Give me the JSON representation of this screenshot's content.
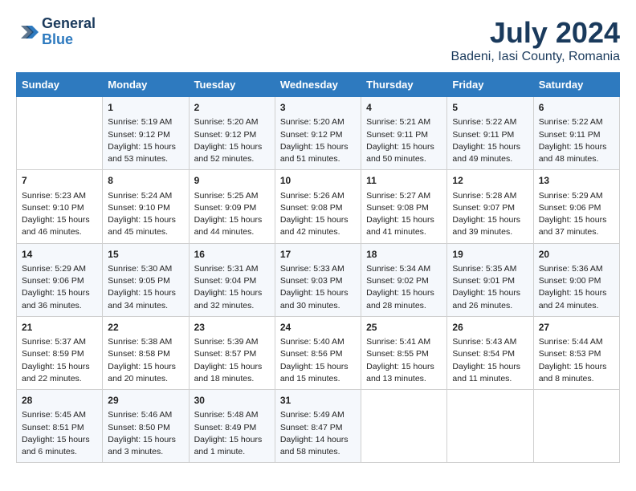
{
  "header": {
    "logo_line1": "General",
    "logo_line2": "Blue",
    "title": "July 2024",
    "subtitle": "Badeni, Iasi County, Romania"
  },
  "days_of_week": [
    "Sunday",
    "Monday",
    "Tuesday",
    "Wednesday",
    "Thursday",
    "Friday",
    "Saturday"
  ],
  "weeks": [
    [
      {
        "day": "",
        "content": ""
      },
      {
        "day": "1",
        "content": "Sunrise: 5:19 AM\nSunset: 9:12 PM\nDaylight: 15 hours\nand 53 minutes."
      },
      {
        "day": "2",
        "content": "Sunrise: 5:20 AM\nSunset: 9:12 PM\nDaylight: 15 hours\nand 52 minutes."
      },
      {
        "day": "3",
        "content": "Sunrise: 5:20 AM\nSunset: 9:12 PM\nDaylight: 15 hours\nand 51 minutes."
      },
      {
        "day": "4",
        "content": "Sunrise: 5:21 AM\nSunset: 9:11 PM\nDaylight: 15 hours\nand 50 minutes."
      },
      {
        "day": "5",
        "content": "Sunrise: 5:22 AM\nSunset: 9:11 PM\nDaylight: 15 hours\nand 49 minutes."
      },
      {
        "day": "6",
        "content": "Sunrise: 5:22 AM\nSunset: 9:11 PM\nDaylight: 15 hours\nand 48 minutes."
      }
    ],
    [
      {
        "day": "7",
        "content": "Sunrise: 5:23 AM\nSunset: 9:10 PM\nDaylight: 15 hours\nand 46 minutes."
      },
      {
        "day": "8",
        "content": "Sunrise: 5:24 AM\nSunset: 9:10 PM\nDaylight: 15 hours\nand 45 minutes."
      },
      {
        "day": "9",
        "content": "Sunrise: 5:25 AM\nSunset: 9:09 PM\nDaylight: 15 hours\nand 44 minutes."
      },
      {
        "day": "10",
        "content": "Sunrise: 5:26 AM\nSunset: 9:08 PM\nDaylight: 15 hours\nand 42 minutes."
      },
      {
        "day": "11",
        "content": "Sunrise: 5:27 AM\nSunset: 9:08 PM\nDaylight: 15 hours\nand 41 minutes."
      },
      {
        "day": "12",
        "content": "Sunrise: 5:28 AM\nSunset: 9:07 PM\nDaylight: 15 hours\nand 39 minutes."
      },
      {
        "day": "13",
        "content": "Sunrise: 5:29 AM\nSunset: 9:06 PM\nDaylight: 15 hours\nand 37 minutes."
      }
    ],
    [
      {
        "day": "14",
        "content": "Sunrise: 5:29 AM\nSunset: 9:06 PM\nDaylight: 15 hours\nand 36 minutes."
      },
      {
        "day": "15",
        "content": "Sunrise: 5:30 AM\nSunset: 9:05 PM\nDaylight: 15 hours\nand 34 minutes."
      },
      {
        "day": "16",
        "content": "Sunrise: 5:31 AM\nSunset: 9:04 PM\nDaylight: 15 hours\nand 32 minutes."
      },
      {
        "day": "17",
        "content": "Sunrise: 5:33 AM\nSunset: 9:03 PM\nDaylight: 15 hours\nand 30 minutes."
      },
      {
        "day": "18",
        "content": "Sunrise: 5:34 AM\nSunset: 9:02 PM\nDaylight: 15 hours\nand 28 minutes."
      },
      {
        "day": "19",
        "content": "Sunrise: 5:35 AM\nSunset: 9:01 PM\nDaylight: 15 hours\nand 26 minutes."
      },
      {
        "day": "20",
        "content": "Sunrise: 5:36 AM\nSunset: 9:00 PM\nDaylight: 15 hours\nand 24 minutes."
      }
    ],
    [
      {
        "day": "21",
        "content": "Sunrise: 5:37 AM\nSunset: 8:59 PM\nDaylight: 15 hours\nand 22 minutes."
      },
      {
        "day": "22",
        "content": "Sunrise: 5:38 AM\nSunset: 8:58 PM\nDaylight: 15 hours\nand 20 minutes."
      },
      {
        "day": "23",
        "content": "Sunrise: 5:39 AM\nSunset: 8:57 PM\nDaylight: 15 hours\nand 18 minutes."
      },
      {
        "day": "24",
        "content": "Sunrise: 5:40 AM\nSunset: 8:56 PM\nDaylight: 15 hours\nand 15 minutes."
      },
      {
        "day": "25",
        "content": "Sunrise: 5:41 AM\nSunset: 8:55 PM\nDaylight: 15 hours\nand 13 minutes."
      },
      {
        "day": "26",
        "content": "Sunrise: 5:43 AM\nSunset: 8:54 PM\nDaylight: 15 hours\nand 11 minutes."
      },
      {
        "day": "27",
        "content": "Sunrise: 5:44 AM\nSunset: 8:53 PM\nDaylight: 15 hours\nand 8 minutes."
      }
    ],
    [
      {
        "day": "28",
        "content": "Sunrise: 5:45 AM\nSunset: 8:51 PM\nDaylight: 15 hours\nand 6 minutes."
      },
      {
        "day": "29",
        "content": "Sunrise: 5:46 AM\nSunset: 8:50 PM\nDaylight: 15 hours\nand 3 minutes."
      },
      {
        "day": "30",
        "content": "Sunrise: 5:48 AM\nSunset: 8:49 PM\nDaylight: 15 hours\nand 1 minute."
      },
      {
        "day": "31",
        "content": "Sunrise: 5:49 AM\nSunset: 8:47 PM\nDaylight: 14 hours\nand 58 minutes."
      },
      {
        "day": "",
        "content": ""
      },
      {
        "day": "",
        "content": ""
      },
      {
        "day": "",
        "content": ""
      }
    ]
  ]
}
